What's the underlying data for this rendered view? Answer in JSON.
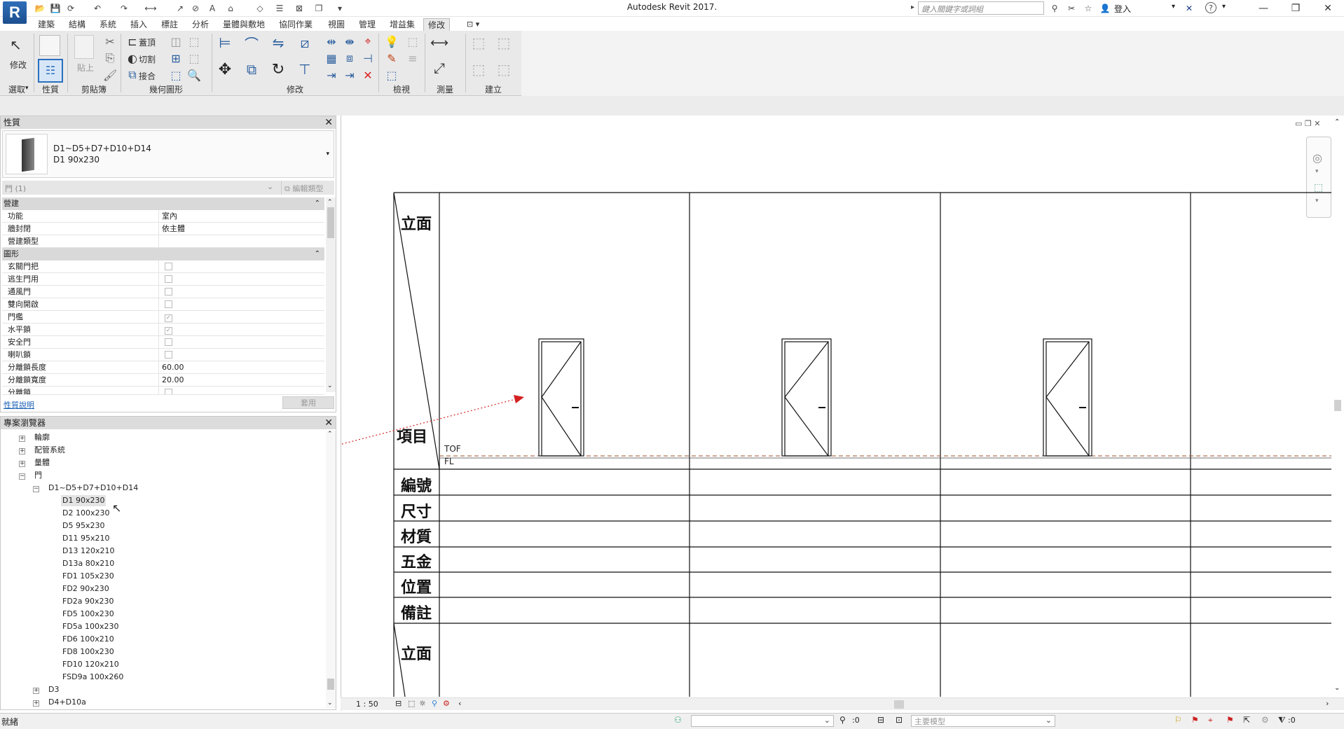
{
  "app": {
    "logo": "R",
    "title": "Autodesk Revit 2017.",
    "search_placeholder": "鍵入關鍵字或詞組",
    "sign_in": "登入",
    "help": "?"
  },
  "tabs": [
    "建築",
    "結構",
    "系統",
    "插入",
    "標註",
    "分析",
    "量體與敷地",
    "協同作業",
    "視圖",
    "管理",
    "增益集",
    "修改"
  ],
  "active_tab": "修改",
  "ribbon": {
    "panels": [
      "選取",
      "性質",
      "剪貼簿",
      "幾何圖形",
      "修改",
      "檢視",
      "測量",
      "建立"
    ],
    "modify_label": "修改",
    "paste_label": "貼上",
    "cope_label": "蓋頂",
    "cut_label": "切割",
    "join_label": "接合"
  },
  "properties": {
    "title": "性質",
    "family_name": "D1~D5+D7+D10+D14",
    "type_name": "D1 90x230",
    "filter": "門 (1)",
    "edit_type": "編輯類型",
    "groups": [
      {
        "name": "營建",
        "rows": [
          {
            "name": "功能",
            "value": "室內"
          },
          {
            "name": "牆封閉",
            "value": "依主體"
          },
          {
            "name": "營建類型",
            "value": ""
          }
        ]
      },
      {
        "name": "圖形",
        "rows": [
          {
            "name": "玄關門把",
            "value": "",
            "check": false
          },
          {
            "name": "逃生門用",
            "value": "",
            "check": false
          },
          {
            "name": "通風門",
            "value": "",
            "check": false
          },
          {
            "name": "雙向開啟",
            "value": "",
            "check": false
          },
          {
            "name": "門檻",
            "value": "",
            "check": true
          },
          {
            "name": "水平鎖",
            "value": "",
            "check": true
          },
          {
            "name": "安全門",
            "value": "",
            "check": false
          },
          {
            "name": "喇叭鎖",
            "value": "",
            "check": false
          },
          {
            "name": "分離鎖長度",
            "value": "60.00"
          },
          {
            "name": "分離鎖寬度",
            "value": "20.00"
          },
          {
            "name": "分離鎖",
            "value": "",
            "check": false
          }
        ]
      }
    ],
    "help_link": "性質說明",
    "apply": "套用"
  },
  "browser": {
    "title": "專案瀏覽器",
    "items": [
      {
        "label": "輪廓",
        "level": 0,
        "toggle": "+"
      },
      {
        "label": "配管系統",
        "level": 0,
        "toggle": "+"
      },
      {
        "label": "量體",
        "level": 0,
        "toggle": "+"
      },
      {
        "label": "門",
        "level": 0,
        "toggle": "-"
      },
      {
        "label": "D1~D5+D7+D10+D14",
        "level": 1,
        "toggle": "-"
      },
      {
        "label": "D1 90x230",
        "level": 2,
        "selected": true
      },
      {
        "label": "D2 100x230",
        "level": 2
      },
      {
        "label": "D5 95x230",
        "level": 2
      },
      {
        "label": "D11 95x210",
        "level": 2
      },
      {
        "label": "D13 120x210",
        "level": 2
      },
      {
        "label": "D13a 80x210",
        "level": 2
      },
      {
        "label": "FD1 105x230",
        "level": 2
      },
      {
        "label": "FD2 90x230",
        "level": 2
      },
      {
        "label": "FD2a 90x230",
        "level": 2
      },
      {
        "label": "FD5 100x230",
        "level": 2
      },
      {
        "label": "FD5a 100x230",
        "level": 2
      },
      {
        "label": "FD6 100x210",
        "level": 2
      },
      {
        "label": "FD8 100x230",
        "level": 2
      },
      {
        "label": "FD10 120x210",
        "level": 2
      },
      {
        "label": "FSD9a 100x260",
        "level": 2
      },
      {
        "label": "D3",
        "level": 1,
        "toggle": "+"
      },
      {
        "label": "D4+D10a",
        "level": 1,
        "toggle": "+"
      }
    ]
  },
  "drawing": {
    "row_labels": [
      "立面",
      "項目",
      "編號",
      "尺寸",
      "材質",
      "五金",
      "位置",
      "備註",
      "立面"
    ],
    "level_top": "TOF",
    "level_floor": "FL"
  },
  "view_bar": {
    "scale": "1 : 50"
  },
  "status": {
    "text": "就緒",
    "workset_count": ":0",
    "design_option": "主要模型",
    "filter_count": ":0"
  }
}
